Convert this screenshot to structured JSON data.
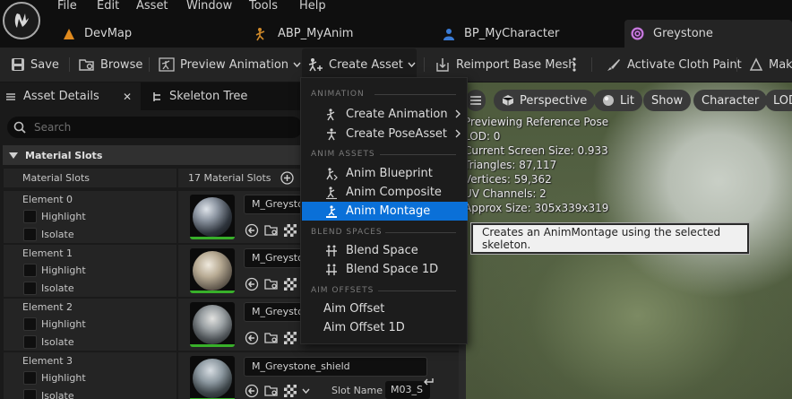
{
  "menubar": {
    "items": [
      "File",
      "Edit",
      "Asset",
      "Window",
      "Tools",
      "Help"
    ]
  },
  "tabs": [
    {
      "label": "DevMap",
      "icon": "level-icon"
    },
    {
      "label": "ABP_MyAnim",
      "icon": "anim-blueprint-icon"
    },
    {
      "label": "BP_MyCharacter",
      "icon": "character-icon"
    },
    {
      "label": "Greystone",
      "icon": "skeleton-icon",
      "active": true
    }
  ],
  "toolbar": {
    "save": "Save",
    "browse": "Browse",
    "preview_animation": "Preview Animation",
    "create_asset": "Create Asset",
    "reimport": "Reimport Base Mesh",
    "cloth_paint": "Activate Cloth Paint",
    "make": "Mak"
  },
  "panel": {
    "tab_details": "Asset Details",
    "tab_skeleton": "Skeleton Tree",
    "search_placeholder": "Search",
    "section_title": "Material Slots",
    "slots_label": "Material Slots",
    "slots_count": "17 Material Slots",
    "elements": [
      {
        "label": "Element 0",
        "material": "M_Greystone",
        "highlight": "Highlight",
        "isolate": "Isolate"
      },
      {
        "label": "Element 1",
        "material": "M_Greystone",
        "highlight": "Highlight",
        "isolate": "Isolate"
      },
      {
        "label": "Element 2",
        "material": "M_Greystone",
        "highlight": "Highlight",
        "isolate": "Isolate"
      },
      {
        "label": "Element 3",
        "material": "M_Greystone_shield",
        "highlight": "Highlight",
        "isolate": "Isolate",
        "slot_name_label": "Slot Name",
        "slot_name": "M03_S"
      }
    ]
  },
  "viewport": {
    "perspective": "Perspective",
    "lit": "Lit",
    "show": "Show",
    "character": "Character",
    "lod": "LOD",
    "info": [
      "Previewing Reference Pose",
      "LOD: 0",
      "Current Screen Size: 0.933",
      "Triangles: 87,117",
      "Vertices: 59,362",
      "UV Channels: 2",
      "Approx Size: 305x339x319"
    ]
  },
  "menu": {
    "section_animation": "ANIMATION",
    "create_animation": "Create Animation",
    "create_poseasset": "Create PoseAsset",
    "section_anim_assets": "ANIM ASSETS",
    "anim_blueprint": "Anim Blueprint",
    "anim_composite": "Anim Composite",
    "anim_montage": "Anim Montage",
    "section_blend_spaces": "BLEND SPACES",
    "blend_space": "Blend Space",
    "blend_space_1d": "Blend Space 1D",
    "section_aim_offsets": "AIM OFFSETS",
    "aim_offset": "Aim Offset",
    "aim_offset_1d": "Aim Offset 1D"
  },
  "tooltip": "Creates an AnimMontage using the selected skeleton.",
  "colors": {
    "accent": "#0a70d8",
    "active_green": "#38b02a",
    "tab_dot": "#c678dd"
  }
}
